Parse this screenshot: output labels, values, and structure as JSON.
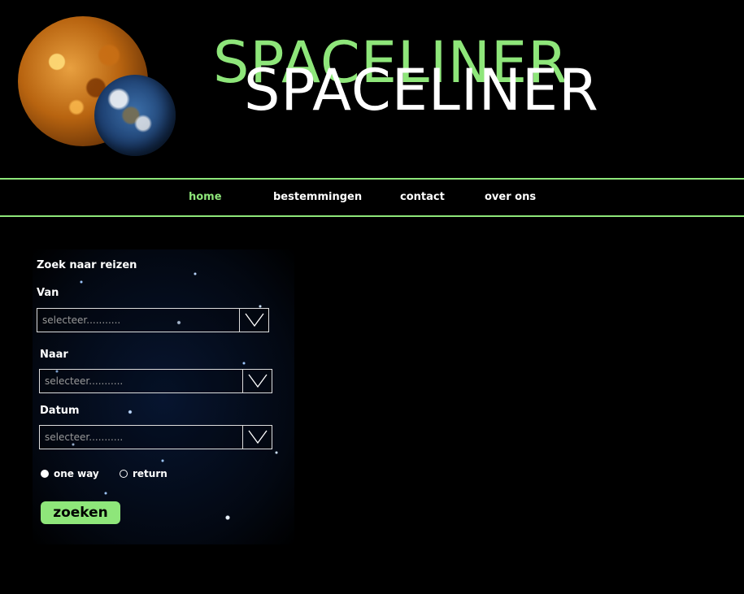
{
  "header": {
    "logo_back": "SPACELINER",
    "logo_front": "SPACELINER",
    "planet_images": [
      "venus",
      "earth"
    ]
  },
  "nav": {
    "items": [
      {
        "label": "home",
        "active": true
      },
      {
        "label": "bestemmingen",
        "active": false
      },
      {
        "label": "contact",
        "active": false
      },
      {
        "label": "over ons",
        "active": false
      }
    ]
  },
  "search": {
    "title": "Zoek naar reizen",
    "from": {
      "label": "Van",
      "value": "selecteer..........."
    },
    "to": {
      "label": "Naar",
      "value": "selecteer..........."
    },
    "date": {
      "label": "Datum",
      "value": "selecteer..........."
    },
    "trip_options": [
      {
        "label": "one way",
        "checked": true
      },
      {
        "label": "return",
        "checked": false
      }
    ],
    "submit_label": "zoeken"
  },
  "colors": {
    "accent": "#8ee67a",
    "background": "#000000",
    "text": "#ffffff",
    "placeholder": "#999999"
  }
}
